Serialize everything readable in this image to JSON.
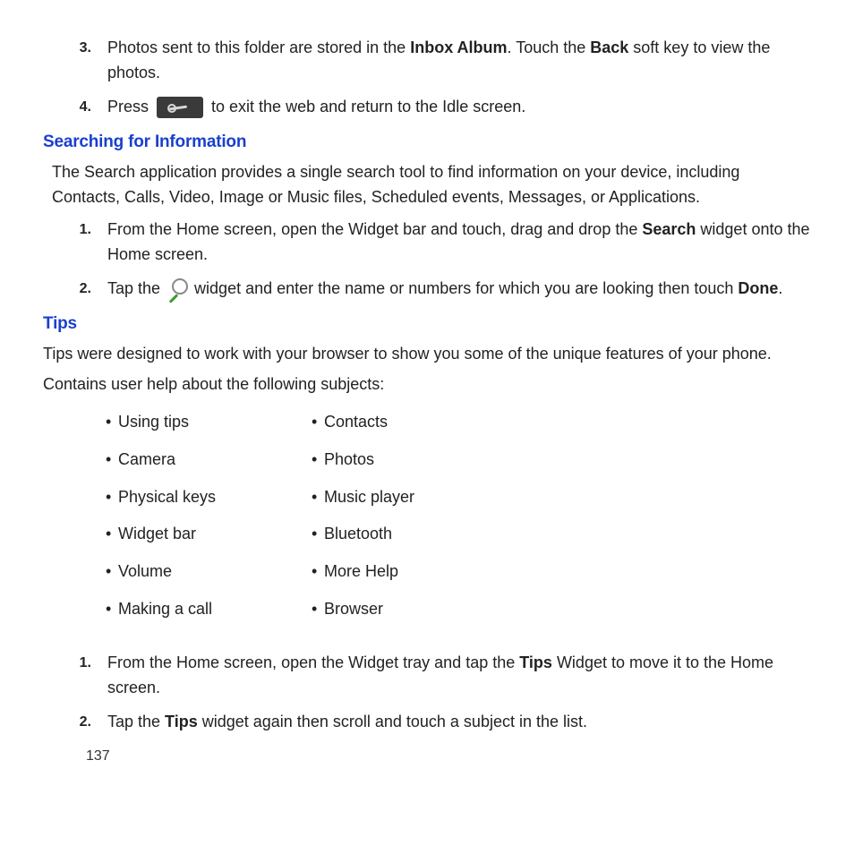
{
  "introSteps": [
    {
      "num": "3.",
      "pre": "Photos sent to this folder are stored in the ",
      "b1": "Inbox Album",
      "mid": ". Touch the ",
      "b2": "Back",
      "post": " soft key to view the photos."
    },
    {
      "num": "4.",
      "pre": "Press ",
      "post": " to exit the web and return to the Idle screen."
    }
  ],
  "heading1": "Searching for Information",
  "heading1_para": "The Search application provides a single search tool to find information on your device, including Contacts, Calls, Video, Image or Music files, Scheduled events, Messages, or Applications.",
  "searchSteps": [
    {
      "num": "1.",
      "pre": "From the Home screen, open the Widget bar and touch, drag and drop the ",
      "b1": "Search",
      "post": " widget onto the Home screen."
    },
    {
      "num": "2.",
      "pre": "Tap the ",
      "mid": " widget and enter the name or numbers for which you are looking then touch ",
      "b1": "Done",
      "post": "."
    }
  ],
  "heading2": "Tips",
  "tips_para1": "Tips were designed to work with your browser to show you some of the unique features of your phone.",
  "tips_para2": "Contains user help about the following subjects:",
  "bulletsCol1": [
    "Using tips",
    "Camera",
    "Physical keys",
    "Widget bar",
    "Volume",
    "Making a call"
  ],
  "bulletsCol2": [
    "Contacts",
    "Photos",
    "Music player",
    "Bluetooth",
    "More Help",
    "Browser"
  ],
  "tipsSteps": [
    {
      "num": "1.",
      "pre": "From the Home screen, open the Widget tray and tap the ",
      "b1": "Tips",
      "post": " Widget to move it to the Home screen."
    },
    {
      "num": "2.",
      "pre": "Tap the ",
      "b1": "Tips",
      "post": " widget again then scroll and touch a subject in the list."
    }
  ],
  "pageNumber": "137"
}
